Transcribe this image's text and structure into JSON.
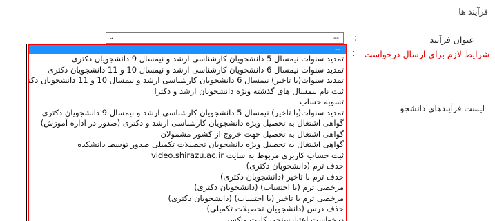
{
  "section": {
    "legend": "فرآیند ها"
  },
  "form": {
    "process_title_label": "عنوان فرآیند",
    "process_title_colon": ":",
    "conditions_label": "شرایط لازم برای ارسال درخواست",
    "conditions_colon": ":",
    "student_processes_label": "لیست فرآیندهای دانشجو",
    "select": {
      "value": "--",
      "arrow": "⌄"
    }
  },
  "dropdown": {
    "selected": "--",
    "options": [
      "تمدید سنوات نیمسال 5 دانشجویان کارشناسی ارشد و نیمسال 9 دانشجویان دکتری",
      "تمدید سنوات نیمسال 6 دانشجویان کارشناسی ارشد و نیمسال 10 و 11 دانشجویان دکتری",
      "تمدید سنوات(با تاخیر) نیمسال 6 دانشجویان کارشناسی ارشد و نیمسال 10 و 11 دانشجویان دکترا",
      "ثبت نام نیمسال های گذشته ویژه دانشجویان ارشد و دکترا",
      "تسویه حساب",
      "تمدید سنوات(با تاخیر) نیمسال 5 دانشجویان کارشناسی ارشد و نیمسال 9 دانشجویان دکتری",
      "گواهی اشتغال به تحصیل ویژه دانشجویان کارشناسی ارشد و دکتری (صدور در اداره آموزش)",
      "گواهی اشتغال به تحصیل جهت خروج از کشور مشمولان",
      "گواهی اشتغال به تحصیل ویژه دانشجویان تحصیلات تکمیلی صدور توسط دانشکده",
      "ثبت حساب کاربری مربوط به سایت video.shirazu.ac.ir",
      "حذف ترم (دانشجویان دکتری)",
      "حذف ترم با تاخیر (دانشجویان دکتری)",
      "مرخصی ترم (با احتساب) (دانشجویان دکتری)",
      "مرخصی ترم با تاخیر (با احتساب) (دانشجویان دکتری)",
      "حذف درس (دانشجویان تحصیلات تکمیلی)",
      "درخواست اعتبارسنجی کارت واکسن"
    ]
  },
  "colors": {
    "conditions_label": "#e00000",
    "dropdown_border": "#ff0000",
    "selected_bg": "#1e90ff"
  }
}
